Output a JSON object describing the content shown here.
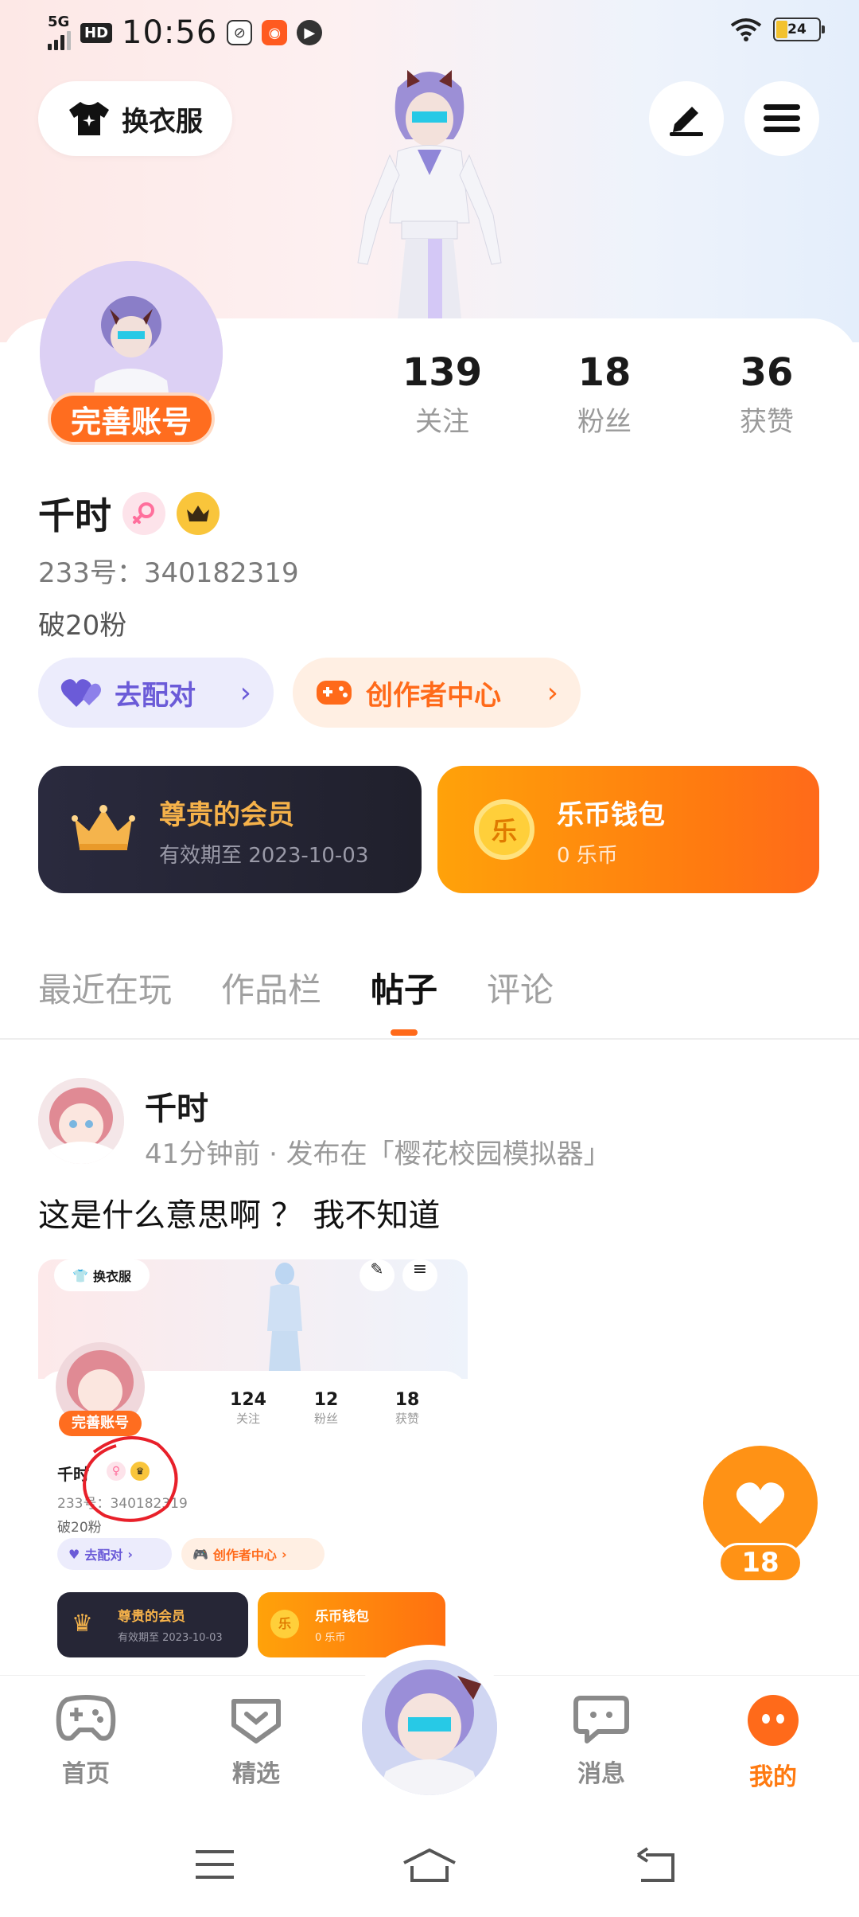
{
  "status_bar": {
    "network": "5G",
    "hd": "HD",
    "time": "10:56",
    "battery": "24"
  },
  "header": {
    "outfit_label": "换衣服"
  },
  "profile": {
    "complete_account_label": "完善账号",
    "stats": [
      {
        "value": "139",
        "label": "关注"
      },
      {
        "value": "18",
        "label": "粉丝"
      },
      {
        "value": "36",
        "label": "获赞"
      }
    ],
    "name": "千时",
    "uid": "233号：340182319",
    "bio": "破20粉",
    "match_label": "去配对",
    "creator_label": "创作者中心",
    "member": {
      "title": "尊贵的会员",
      "subtitle": "有效期至 2023-10-03"
    },
    "wallet": {
      "title": "乐币钱包",
      "subtitle": "0 乐币",
      "coin_glyph": "乐"
    }
  },
  "tabs": [
    {
      "label": "最近在玩",
      "active": false
    },
    {
      "label": "作品栏",
      "active": false
    },
    {
      "label": "帖子",
      "active": true
    },
    {
      "label": "评论",
      "active": false
    }
  ],
  "post": {
    "author": "千时",
    "meta": "41分钟前 · 发布在「樱花校园模拟器」",
    "text": "这是什么意思啊 ？ 我不知道",
    "like_count": "18",
    "image": {
      "outfit_label": "换衣服",
      "complete_account_label": "完善账号",
      "stats": [
        {
          "value": "124",
          "label": "关注"
        },
        {
          "value": "12",
          "label": "粉丝"
        },
        {
          "value": "18",
          "label": "获赞"
        }
      ],
      "name": "千时",
      "uid": "233号：340182319",
      "bio": "破20粉",
      "match_label": "去配对",
      "creator_label": "创作者中心",
      "member_title": "尊贵的会员",
      "member_subtitle": "有效期至 2023-10-03",
      "wallet_title": "乐币钱包",
      "wallet_subtitle": "0 乐币"
    }
  },
  "bottom_nav": [
    {
      "label": "首页",
      "icon": "gamepad-icon",
      "active": false
    },
    {
      "label": "精选",
      "icon": "heart-box-icon",
      "active": false
    },
    {
      "label": "消息",
      "icon": "chat-icon",
      "active": false
    },
    {
      "label": "我的",
      "icon": "me-icon",
      "active": true
    }
  ],
  "colors": {
    "accent": "#ff6a1a",
    "like": "#ff9215",
    "purple": "#6b5bd8"
  }
}
